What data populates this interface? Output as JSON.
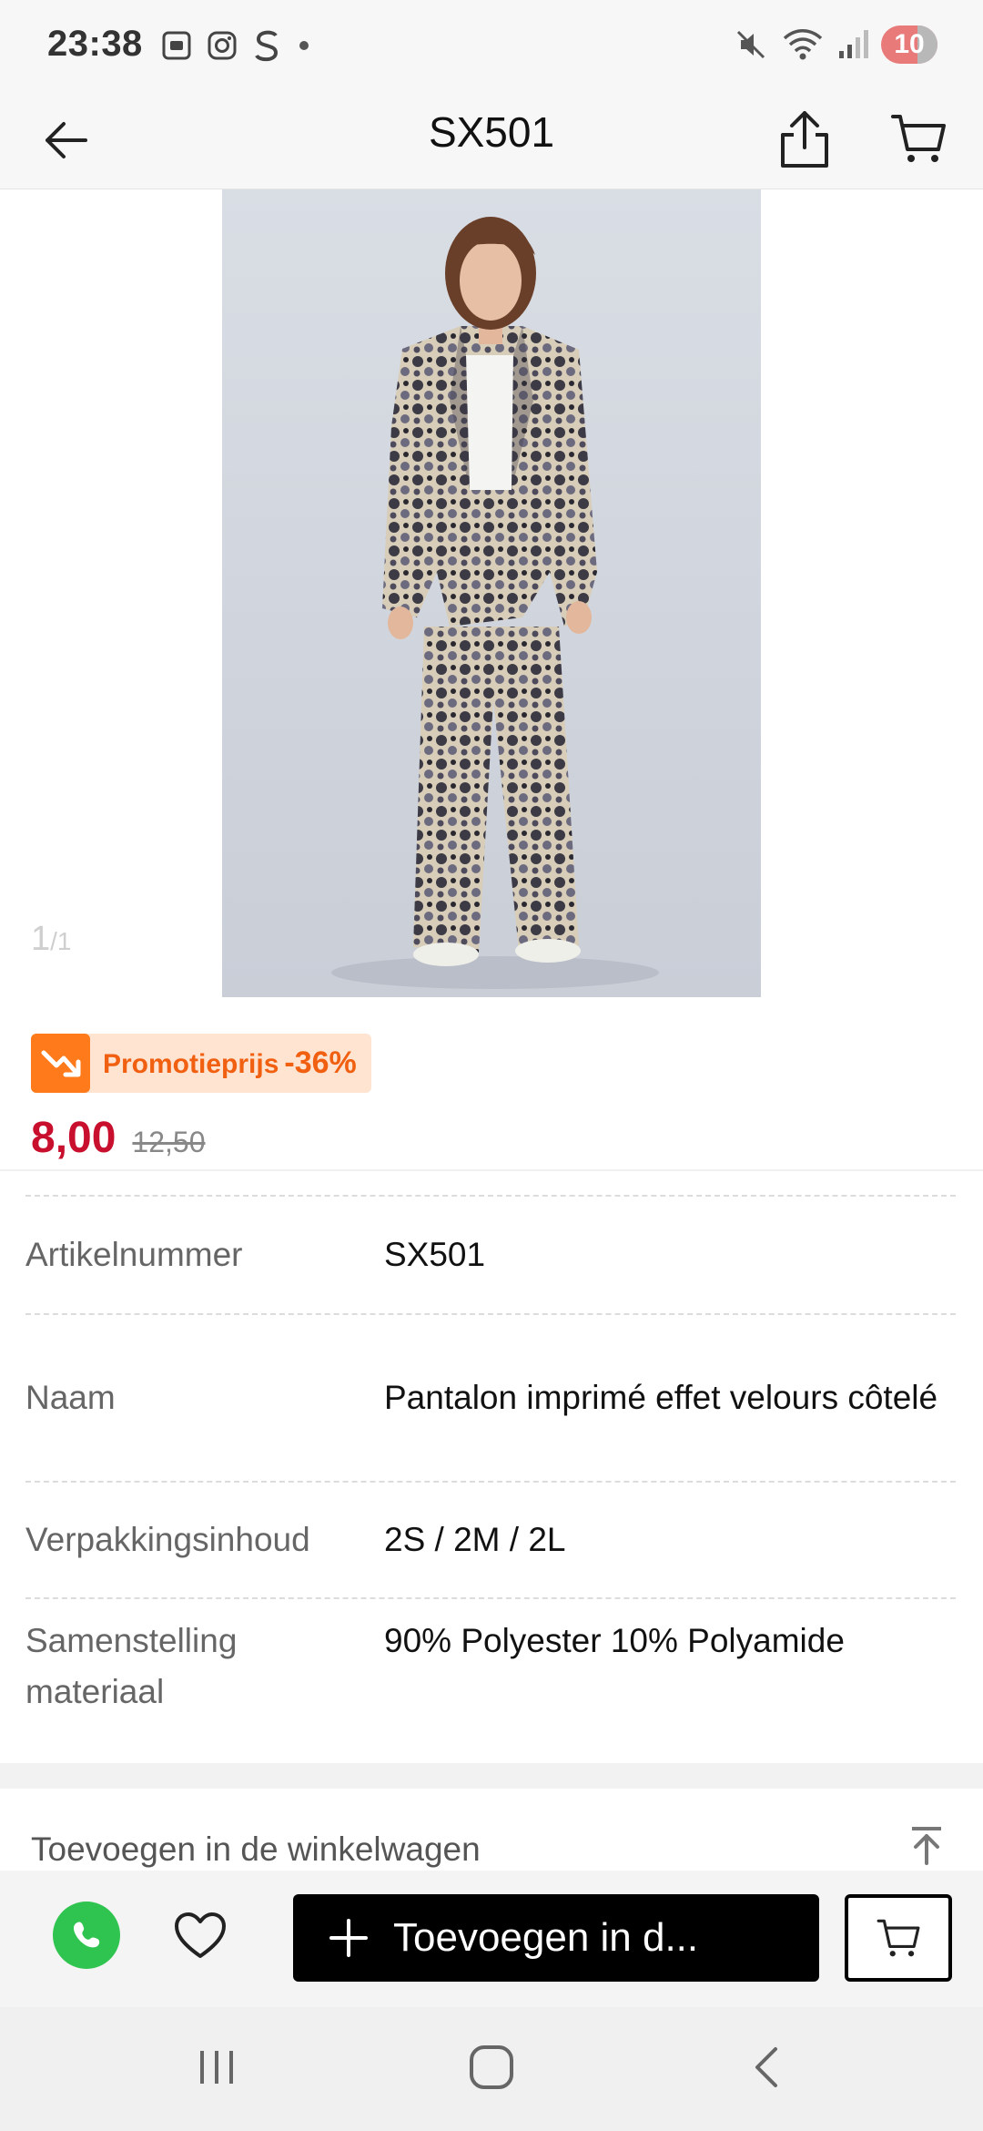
{
  "status_bar": {
    "time": "23:38",
    "battery": "10",
    "left_icons": [
      "screenshot-icon",
      "instagram-icon",
      "s-app-icon",
      "dot-icon"
    ],
    "right_icons": [
      "mute-icon",
      "wifi-icon",
      "signal-icon"
    ]
  },
  "app_bar": {
    "title": "SX501",
    "back_icon": "arrow-left-icon",
    "share_icon": "share-icon",
    "cart_icon": "cart-icon"
  },
  "gallery": {
    "current": "1",
    "total": "/1"
  },
  "promo": {
    "label": "Promotieprijs",
    "discount": "-36%",
    "price_now": "8,00",
    "price_old": "12,50",
    "accent": "#ff7a1a",
    "price_color": "#c8102e"
  },
  "specs": [
    {
      "label": "Artikelnummer",
      "value": "SX501"
    },
    {
      "label": "Naam",
      "value": "Pantalon imprimé effet velours côtelé"
    },
    {
      "label": "Verpakkingsinhoud",
      "value": "2S / 2M / 2L"
    },
    {
      "label": "Samenstelling materiaal",
      "value": "90% Polyester 10% Polyamide"
    }
  ],
  "add_section": {
    "title": "Toevoegen in de winkelwagen"
  },
  "bottom_bar": {
    "add_button_label": "Toevoegen in d..."
  }
}
